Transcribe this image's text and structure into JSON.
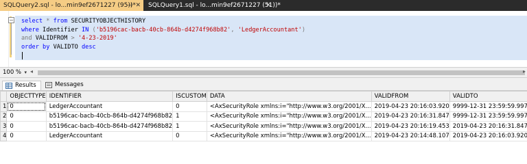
{
  "tabs": [
    {
      "label": "SQLQuery2.sql - lo...min9ef2671227 (95))*",
      "active": true
    },
    {
      "label": "SQLQuery1.sql - lo...min9ef2671227 (51))*",
      "active": false
    }
  ],
  "tab_close_glyph": "✕",
  "tab_pin_glyph": "⊣",
  "editor": {
    "lines": [
      [
        {
          "t": "kw",
          "v": "select"
        },
        {
          "t": "txt",
          "v": " "
        },
        {
          "t": "op",
          "v": "*"
        },
        {
          "t": "txt",
          "v": " "
        },
        {
          "t": "kw",
          "v": "from"
        },
        {
          "t": "txt",
          "v": " SECURITYOBJECTHISTORY"
        }
      ],
      [
        {
          "t": "kw",
          "v": "where"
        },
        {
          "t": "txt",
          "v": " Identifier "
        },
        {
          "t": "kw",
          "v": "IN"
        },
        {
          "t": "txt",
          "v": " "
        },
        {
          "t": "op",
          "v": "("
        },
        {
          "t": "str",
          "v": "'b5196cac-bacb-40cb-864b-d4274f968b82'"
        },
        {
          "t": "op",
          "v": ","
        },
        {
          "t": "txt",
          "v": " "
        },
        {
          "t": "str",
          "v": "'LedgerAccountant'"
        },
        {
          "t": "op",
          "v": ")"
        }
      ],
      [
        {
          "t": "op",
          "v": "and"
        },
        {
          "t": "txt",
          "v": " VALIDFROM "
        },
        {
          "t": "op",
          "v": ">"
        },
        {
          "t": "txt",
          "v": " "
        },
        {
          "t": "str",
          "v": "'4-23-2019'"
        }
      ],
      [
        {
          "t": "kw",
          "v": "order by"
        },
        {
          "t": "txt",
          "v": " VALIDTO "
        },
        {
          "t": "kw",
          "v": "desc"
        }
      ],
      []
    ]
  },
  "zoom": {
    "value": "100 %",
    "chevron": "▾"
  },
  "scroll_arrows": {
    "left": "◂",
    "right": "▸"
  },
  "result_tabs": [
    {
      "label": "Results",
      "icon": "grid-icon",
      "active": true
    },
    {
      "label": "Messages",
      "icon": "messages-icon",
      "active": false
    }
  ],
  "grid": {
    "columns": [
      "",
      "OBJECTTYPE",
      "IDENTIFIER",
      "ISCUSTOM",
      "DATA",
      "VALIDFROM",
      "VALIDTO"
    ],
    "rows": [
      [
        "1",
        "0",
        "LedgerAccountant",
        "0",
        "<AxSecurityRole xmlns:i=\"http://www.w3.org/2001/X...",
        "2019-04-23 20:16:03.920",
        "9999-12-31 23:59:59.997"
      ],
      [
        "2",
        "0",
        "b5196cac-bacb-40cb-864b-d4274f968b82",
        "1",
        "<AxSecurityRole xmlns:i=\"http://www.w3.org/2001/X...",
        "2019-04-23 20:16:31.847",
        "9999-12-31 23:59:59.997"
      ],
      [
        "3",
        "0",
        "b5196cac-bacb-40cb-864b-d4274f968b82",
        "1",
        "<AxSecurityRole xmlns:i=\"http://www.w3.org/2001/X...",
        "2019-04-23 20:16:19.453",
        "2019-04-23 20:16:31.847"
      ],
      [
        "4",
        "0",
        "LedgerAccountant",
        "0",
        "<AxSecurityRole xmlns:i=\"http://www.w3.org/2001/X...",
        "2019-04-23 20:14:48.107",
        "2019-04-23 20:16:03.920"
      ]
    ]
  },
  "colors": {
    "active_tab": "#f5cc84",
    "tab_strip": "#2b2b2b",
    "keyword": "#0000ff",
    "string": "#c00000",
    "operator": "#7a7a7a",
    "selection": "#d9e6f7"
  }
}
